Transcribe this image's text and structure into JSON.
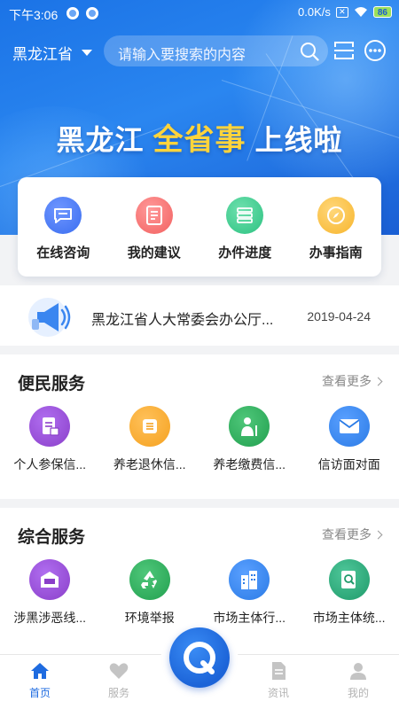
{
  "status_bar": {
    "time": "下午3:06",
    "speed": "0.0K/s",
    "battery": "86"
  },
  "header": {
    "region": "黑龙江省",
    "search_placeholder": "请输入要搜索的内容"
  },
  "banner": {
    "part1": "黑龙江",
    "highlight": "全省事",
    "part2": "上线啦"
  },
  "quick_actions": [
    {
      "label": "在线咨询",
      "icon": "chat-icon",
      "color": "#3a6df0"
    },
    {
      "label": "我的建议",
      "icon": "document-icon",
      "color": "#f2605f"
    },
    {
      "label": "办件进度",
      "icon": "progress-list-icon",
      "color": "#2cc281"
    },
    {
      "label": "办事指南",
      "icon": "compass-icon",
      "color": "#f7b52c"
    }
  ],
  "notice": {
    "text": "黑龙江省人大常委会办公厅...",
    "date": "2019-04-24",
    "icon": "megaphone-icon"
  },
  "convenience": {
    "title": "便民服务",
    "more": "查看更多",
    "items": [
      {
        "label": "个人参保信...",
        "icon": "insurance-doc-icon",
        "color": "#8a3fc9"
      },
      {
        "label": "养老退休信...",
        "icon": "list-doc-icon",
        "color": "#f5a11f"
      },
      {
        "label": "养老缴费信...",
        "icon": "elderly-person-icon",
        "color": "#22a04f"
      },
      {
        "label": "信访面对面",
        "icon": "envelope-icon",
        "color": "#2b7be6"
      }
    ]
  },
  "comprehensive": {
    "title": "综合服务",
    "more": "查看更多",
    "items": [
      {
        "label": "涉黑涉恶线...",
        "icon": "report-box-icon",
        "color": "#8a3fc9"
      },
      {
        "label": "环境举报",
        "icon": "recycle-icon",
        "color": "#22a04f"
      },
      {
        "label": "市场主体行...",
        "icon": "building-icon",
        "color": "#2b7be6"
      },
      {
        "label": "市场主体统...",
        "icon": "search-doc-icon",
        "color": "#1f9a6a"
      }
    ]
  },
  "bottom_nav": [
    {
      "label": "首页",
      "icon": "home-icon",
      "active": true
    },
    {
      "label": "服务",
      "icon": "heart-icon",
      "active": false
    },
    {
      "label": "资讯",
      "icon": "news-icon",
      "active": false
    },
    {
      "label": "我的",
      "icon": "person-icon",
      "active": false
    }
  ],
  "colors": {
    "primary": "#1e6be0",
    "banner_highlight": "#ffd43b"
  }
}
